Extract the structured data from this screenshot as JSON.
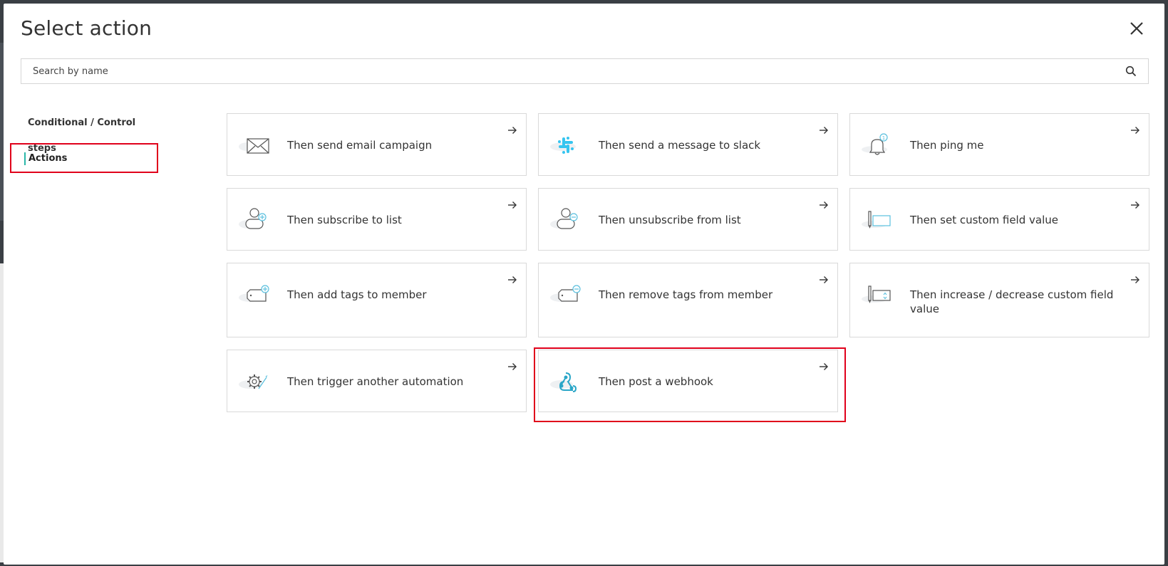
{
  "modal": {
    "title": "Select action"
  },
  "search": {
    "placeholder": "Search by name",
    "value": ""
  },
  "sidebar": {
    "items": [
      {
        "label": "Conditional / Control steps",
        "active": false
      },
      {
        "label": "Actions",
        "active": true
      }
    ]
  },
  "actions": [
    {
      "label": "Then send email campaign",
      "icon": "envelope-icon"
    },
    {
      "label": "Then send a message to slack",
      "icon": "slack-icon"
    },
    {
      "label": "Then ping me",
      "icon": "bell-icon"
    },
    {
      "label": "Then subscribe to list",
      "icon": "user-add-icon"
    },
    {
      "label": "Then unsubscribe from list",
      "icon": "user-remove-icon"
    },
    {
      "label": "Then set custom field value",
      "icon": "custom-field-icon"
    },
    {
      "label": "Then add tags to member",
      "icon": "tag-add-icon"
    },
    {
      "label": "Then remove tags from member",
      "icon": "tag-remove-icon"
    },
    {
      "label": "Then increase / decrease custom field value",
      "icon": "field-stepper-icon"
    },
    {
      "label": "Then trigger another automation",
      "icon": "gear-icon"
    },
    {
      "label": "Then post a webhook",
      "icon": "webhook-icon"
    }
  ],
  "colors": {
    "accent": "#2ab7a9",
    "slack": "#36c5f0",
    "highlight": "#e0001b",
    "icon_blue": "#5bc0de"
  }
}
